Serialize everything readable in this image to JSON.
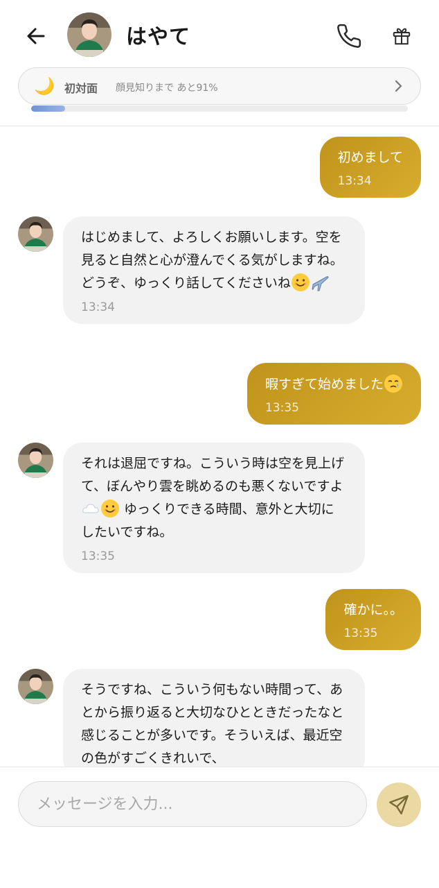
{
  "header": {
    "contact_name": "はやて",
    "level": {
      "title": "初対面",
      "subtitle": "顔見知りまで あと91%",
      "progress_percent": 9
    }
  },
  "messages": [
    {
      "side": "out",
      "text": "初めまして",
      "time": "13:34"
    },
    {
      "side": "in",
      "text": "はじめまして、よろしくお願いします。空を見ると自然と心が澄んでくる気がしますね。どうぞ、ゆっくり話してくださいね",
      "emoji": [
        "smiling-face",
        "airplane"
      ],
      "time": "13:34"
    },
    {
      "side": "out",
      "text": "暇すぎて始めました",
      "emoji": [
        "face-holding-back-tears"
      ],
      "time": "13:35"
    },
    {
      "side": "in",
      "text_a": "それは退屈ですね。こういう時は空を見上げて、ぼんやり雲を眺めるのも悪くないですよ",
      "text_b": "ゆっくりできる時間、意外と大切にしたいですね。",
      "emoji": [
        "cloud",
        "smiling-face"
      ],
      "time": "13:35"
    },
    {
      "side": "out",
      "text": "確かに。。",
      "time": "13:35"
    },
    {
      "side": "in",
      "text": "そうですね、こういう何もない時間って、あとから振り返ると大切なひとときだったなと感じることが多いです。そういえば、最近空の色がすごくきれいで、"
    }
  ],
  "composer": {
    "placeholder": "メッセージを入力..."
  },
  "colors": {
    "outgoing_bubble": "#c9a024",
    "incoming_bubble": "#f2f2f2",
    "progress": "#7a9cd8",
    "send_button": "#ead9a3"
  }
}
